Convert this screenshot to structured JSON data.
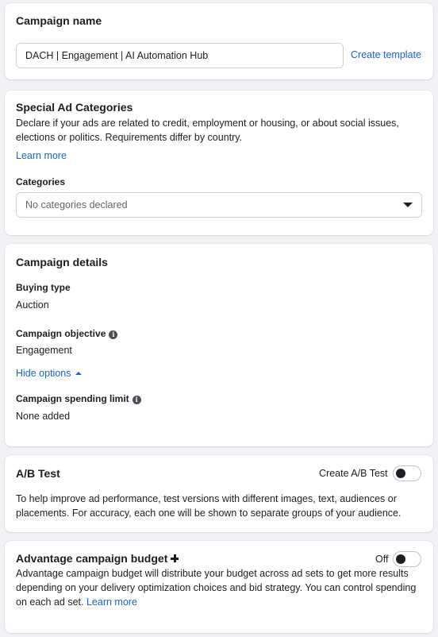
{
  "campaign_name": {
    "title": "Campaign name",
    "input_value": "DACH | Engagement | AI Automation Hub",
    "create_template_label": "Create template"
  },
  "special_ad_categories": {
    "title": "Special Ad Categories",
    "description": "Declare if your ads are related to credit, employment or housing, or about social issues, elections or politics. Requirements differ by country.",
    "learn_more_label": "Learn more",
    "categories_label": "Categories",
    "categories_placeholder": "No categories declared"
  },
  "campaign_details": {
    "title": "Campaign details",
    "buying_type_label": "Buying type",
    "buying_type_value": "Auction",
    "objective_label": "Campaign objective",
    "objective_value": "Engagement",
    "hide_options_label": "Hide options",
    "spending_limit_label": "Campaign spending limit",
    "spending_limit_value": "None added"
  },
  "ab_test": {
    "title": "A/B Test",
    "toggle_label": "Create A/B Test",
    "toggle_on": false,
    "description": "To help improve ad performance, test versions with different images, text, audiences or placements. For accuracy, each one will be shown to separate groups of your audience."
  },
  "advantage_budget": {
    "title": "Advantage campaign budget",
    "toggle_label": "Off",
    "toggle_on": false,
    "description": "Advantage campaign budget will distribute your budget across ad sets to get more results depending on your delivery optimization choices and bid strategy. You can control spending on each ad set.",
    "learn_more_label": "Learn more"
  },
  "icons": {
    "info": "info-icon",
    "dropdown": "caret-down-icon",
    "collapse": "caret-up-icon",
    "advantage": "plus-icon"
  },
  "colors": {
    "link": "#1763cf",
    "background": "#f0f2f5",
    "card": "#ffffff",
    "text": "#1c1e21"
  }
}
